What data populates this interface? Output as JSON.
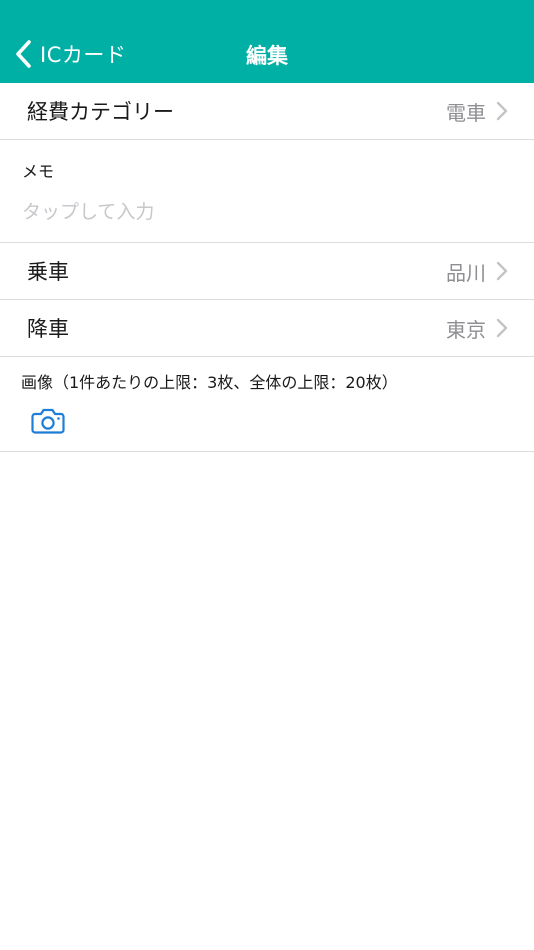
{
  "nav": {
    "back_label": "ICカード",
    "title": "編集"
  },
  "rows": {
    "category": {
      "label": "経費カテゴリー",
      "value": "電車"
    },
    "board": {
      "label": "乗車",
      "value": "品川"
    },
    "alight": {
      "label": "降車",
      "value": "東京"
    }
  },
  "memo": {
    "label": "メモ",
    "placeholder": "タップして入力",
    "value": ""
  },
  "images": {
    "label": "画像（1件あたりの上限：3枚、全体の上限：20枚）"
  },
  "colors": {
    "accent": "#00b0a5",
    "camera_icon": "#1e7ed6",
    "secondary_text": "#8e8e93",
    "placeholder": "#c7c7cc"
  },
  "icons": {
    "back": "chevron-left-icon",
    "row_disclosure": "chevron-right-icon",
    "camera": "camera-icon"
  }
}
